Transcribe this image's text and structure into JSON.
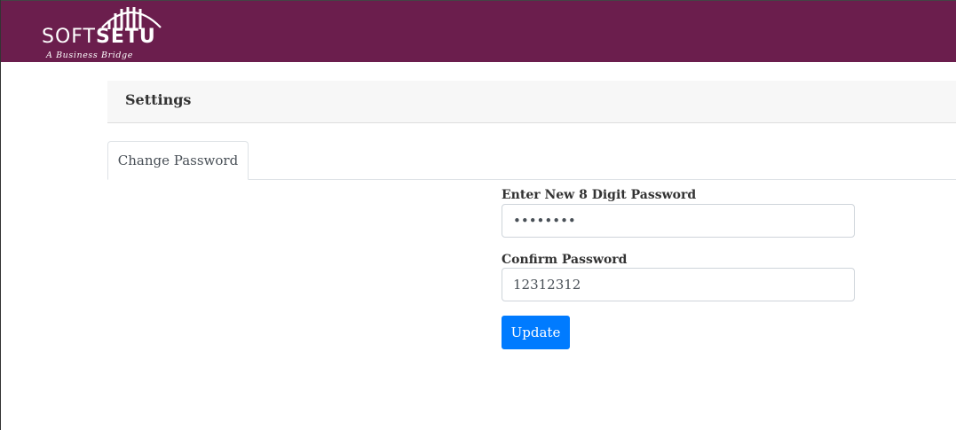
{
  "brand": {
    "name_part1": "SOFT",
    "name_part2": "SETU",
    "tagline": "A Business Bridge",
    "bar_color": "#6b1e4d",
    "logo_icon": "bridge-arch-icon"
  },
  "settings": {
    "title": "Settings"
  },
  "tabs": [
    {
      "label": "Change Password",
      "active": true
    }
  ],
  "form": {
    "new_password": {
      "label": "Enter New 8 Digit Password",
      "value": "12312312",
      "type": "password"
    },
    "confirm_password": {
      "label": "Confirm Password",
      "value": "12312312",
      "type": "text"
    },
    "submit_label": "Update",
    "submit_color": "#007bff"
  }
}
